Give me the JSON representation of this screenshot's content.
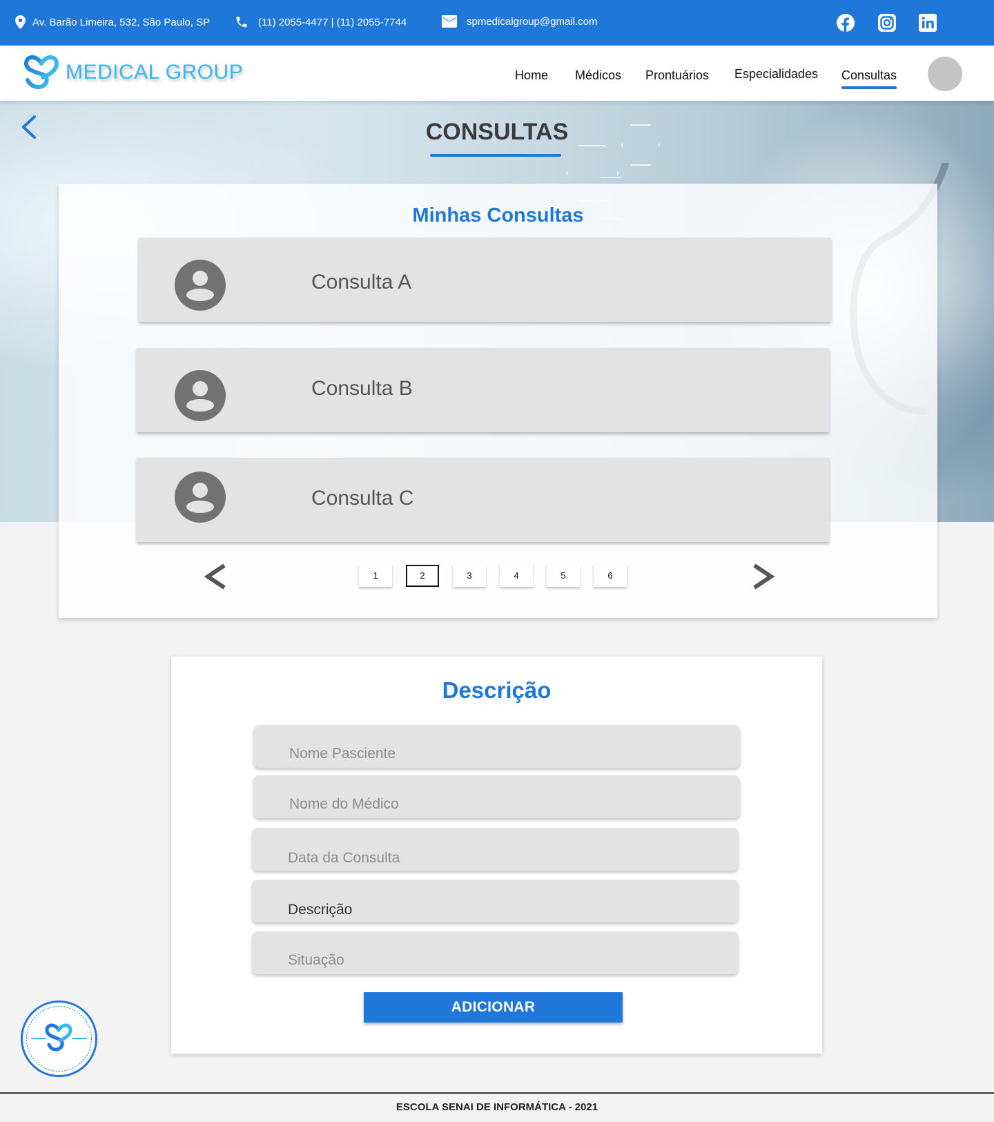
{
  "topbar": {
    "address": "Av. Barão Limeira, 532, São Paulo, SP",
    "phones": "(11) 2055-4477 | (11) 2055-7744",
    "email": "spmedicalgroup@gmail.com",
    "social_icons": [
      "facebook-icon",
      "instagram-icon",
      "linkedin-icon"
    ],
    "background_color": "#1f78d9"
  },
  "brand": {
    "name": "MEDICAL GROUP",
    "color": "#3ab7ec"
  },
  "nav": {
    "items": [
      {
        "label": "Home",
        "active": false
      },
      {
        "label": "Médicos",
        "active": false
      },
      {
        "label": "Prontuários",
        "active": false
      },
      {
        "label": "Especialidades",
        "active": false
      },
      {
        "label": "Consultas",
        "active": true
      }
    ]
  },
  "page": {
    "title": "CONSULTAS"
  },
  "consultas": {
    "title": "Minhas Consultas",
    "items": [
      {
        "label": "Consulta A"
      },
      {
        "label": "Consulta B"
      },
      {
        "label": "Consulta C"
      }
    ],
    "pagination": {
      "pages": [
        "1",
        "2",
        "3",
        "4",
        "5",
        "6"
      ],
      "current": "2"
    }
  },
  "form": {
    "title": "Descrição",
    "fields": {
      "patient": {
        "placeholder": "Nome Pasciente",
        "value": ""
      },
      "doctor": {
        "placeholder": "Nome do Médico",
        "value": ""
      },
      "date": {
        "placeholder": "Data da Consulta",
        "value": ""
      },
      "description": {
        "placeholder": "Descrição",
        "value": "Descrição"
      },
      "status": {
        "placeholder": "Situação",
        "value": ""
      }
    },
    "submit_label": "ADICIONAR"
  },
  "footer": {
    "text": "ESCOLA SENAI DE INFORMÁTICA - 2021"
  },
  "colors": {
    "accent": "#1f78d9",
    "card": "#e3e3e3",
    "page_bg": "#f3f3f3"
  }
}
